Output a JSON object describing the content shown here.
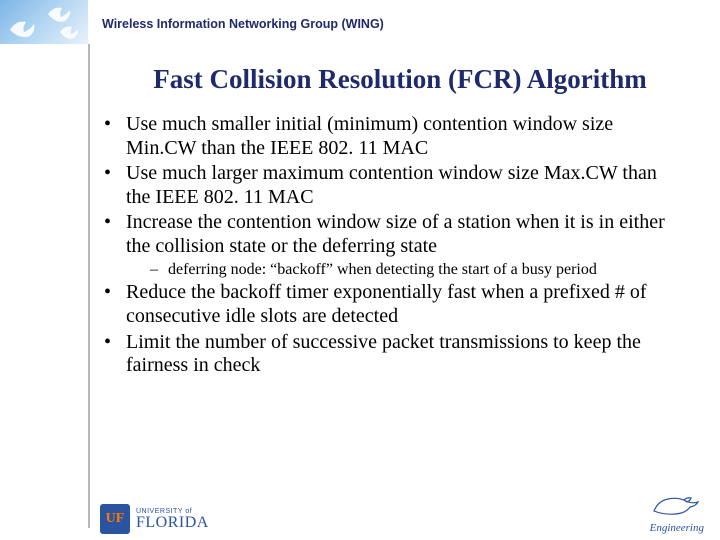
{
  "header": {
    "group_name": "Wireless Information Networking Group (WING)"
  },
  "title": "Fast Collision Resolution (FCR) Algorithm",
  "bullets": {
    "b1": "Use much smaller initial (minimum) contention window size Min.CW than the IEEE 802. 11 MAC",
    "b2": "Use much larger maximum contention window size Max.CW than the IEEE 802. 11 MAC",
    "b3": "Increase the contention window size of a station when it is in either the collision state or the deferring state",
    "b3_sub1": "deferring node: “backoff” when detecting the start of a busy period",
    "b4": "Reduce the backoff timer exponentially fast when a prefixed # of consecutive idle slots are detected",
    "b5": "Limit the number of successive packet transmissions to keep the fairness in check"
  },
  "footer": {
    "uf_mark": "UF",
    "uf_small": "UNIVERSITY of",
    "uf_big": "FLORIDA",
    "eng_text": "Engineering"
  }
}
